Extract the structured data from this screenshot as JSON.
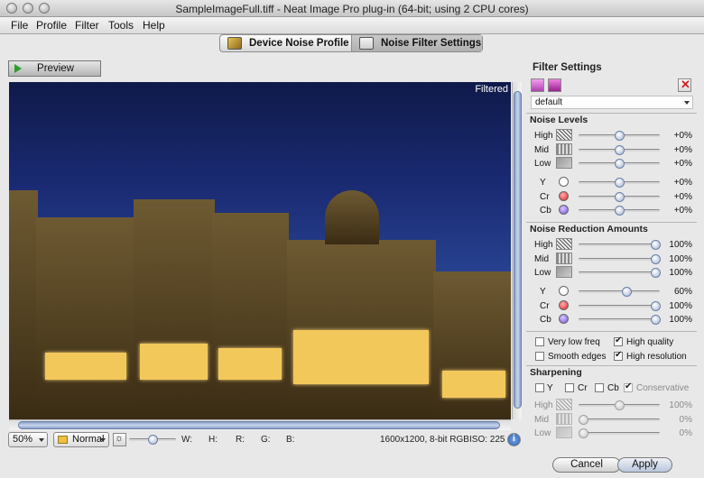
{
  "window": {
    "title": "SampleImageFull.tiff - Neat Image Pro plug-in (64-bit; using 2 CPU cores)"
  },
  "menu": {
    "items": [
      "File",
      "Profile",
      "Filter",
      "Tools",
      "Help"
    ]
  },
  "tabs": [
    {
      "label": "Device Noise Profile",
      "icon": "noise-profile-icon"
    },
    {
      "label": "Noise Filter Settings",
      "icon": "filter-settings-icon",
      "selected": true
    }
  ],
  "preview": {
    "button_label": "Preview",
    "overlay_label": "Filtered"
  },
  "status": {
    "zoom": "50%",
    "mode": "Normal",
    "w_label": "W:",
    "h_label": "H:",
    "r_label": "R:",
    "g_label": "G:",
    "b_label": "B:",
    "image_info": "1600x1200, 8-bit RGB",
    "iso": "ISO: 225"
  },
  "filter_settings": {
    "title": "Filter Settings",
    "preset": "default",
    "noise_levels": {
      "title": "Noise Levels",
      "rows": [
        {
          "label": "High",
          "value": "+0%",
          "position": 0.5
        },
        {
          "label": "Mid",
          "value": "+0%",
          "position": 0.5
        },
        {
          "label": "Low",
          "value": "+0%",
          "position": 0.5
        },
        {
          "label": "Y",
          "value": "+0%",
          "position": 0.5
        },
        {
          "label": "Cr",
          "value": "+0%",
          "position": 0.5
        },
        {
          "label": "Cb",
          "value": "+0%",
          "position": 0.5
        }
      ]
    },
    "noise_reduction": {
      "title": "Noise Reduction Amounts",
      "rows": [
        {
          "label": "High",
          "value": "100%",
          "position": 1.0
        },
        {
          "label": "Mid",
          "value": "100%",
          "position": 1.0
        },
        {
          "label": "Low",
          "value": "100%",
          "position": 1.0
        },
        {
          "label": "Y",
          "value": "60%",
          "position": 0.6
        },
        {
          "label": "Cr",
          "value": "100%",
          "position": 1.0
        },
        {
          "label": "Cb",
          "value": "100%",
          "position": 1.0
        }
      ]
    },
    "options": [
      {
        "label": "Very low freq",
        "checked": false
      },
      {
        "label": "High quality",
        "checked": true
      },
      {
        "label": "Smooth edges",
        "checked": false
      },
      {
        "label": "High resolution",
        "checked": true
      }
    ],
    "sharpening": {
      "title": "Sharpening",
      "channels": [
        {
          "label": "Y",
          "checked": false
        },
        {
          "label": "Cr",
          "checked": false
        },
        {
          "label": "Cb",
          "checked": false
        },
        {
          "label": "Conservative",
          "checked": true
        }
      ],
      "rows": [
        {
          "label": "High",
          "value": "100%",
          "position": 0.5
        },
        {
          "label": "Mid",
          "value": "0%",
          "position": 0.0
        },
        {
          "label": "Low",
          "value": "0%",
          "position": 0.0
        }
      ]
    }
  },
  "buttons": {
    "cancel": "Cancel",
    "apply": "Apply"
  }
}
